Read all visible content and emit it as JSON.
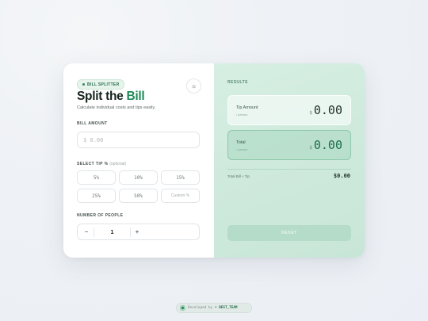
{
  "badge": {
    "label": "BILL SPLITTER"
  },
  "header": {
    "title_part1": "Split the",
    "title_accent": "Bill",
    "subtitle": "Calculate individual costs and tips easily.",
    "theme_icon": "sun-icon"
  },
  "bill": {
    "label": "BILL AMOUNT",
    "placeholder": "$ 0.00"
  },
  "tip": {
    "label": "SELECT TIP %",
    "optional": "(optional)",
    "options": [
      "5%",
      "10%",
      "15%",
      "25%",
      "50%"
    ],
    "custom_placeholder": "Custom %"
  },
  "people": {
    "label": "NUMBER OF PEOPLE",
    "minus": "−",
    "plus": "+",
    "value": "1"
  },
  "results": {
    "label": "RESULTS",
    "tip_amount": {
      "name": "Tip Amount",
      "sub": "/ person",
      "currency": "$",
      "value": "0.00"
    },
    "total": {
      "name": "Total",
      "sub": "/ person",
      "currency": "$",
      "value": "0.00"
    },
    "summary_label": "Total Bill + Tip",
    "summary_value": "$0.00",
    "reset_label": "RESET"
  },
  "footer": {
    "developed_by": "Developed by",
    "team": "• BEST_TEAM"
  },
  "colors": {
    "accent": "#1f8a58",
    "results_bg": "#cfeadd",
    "reset_bg": "#b5dcc8"
  }
}
